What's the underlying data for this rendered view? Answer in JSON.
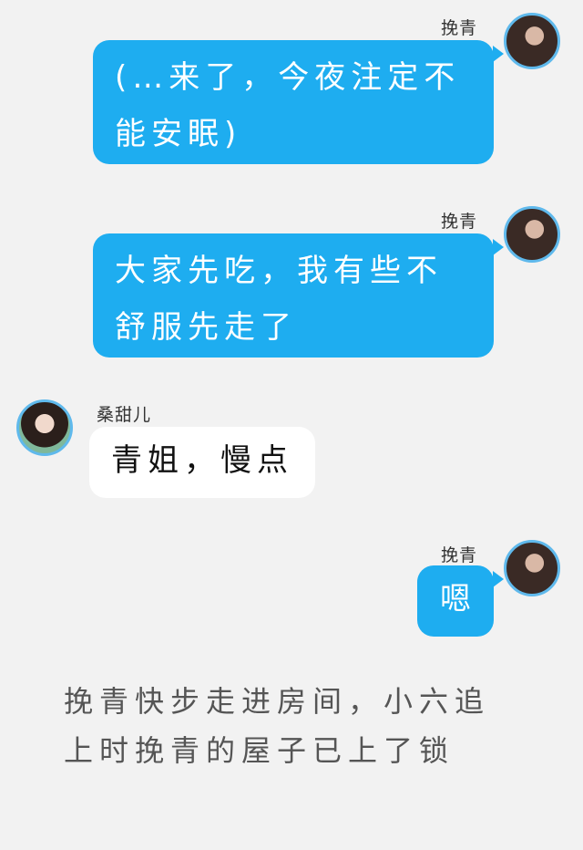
{
  "messages": [
    {
      "sender": "挽青",
      "side": "right",
      "text": "(…来了，今夜注定不能安眠)"
    },
    {
      "sender": "挽青",
      "side": "right",
      "text": "大家先吃，我有些不舒服先走了"
    },
    {
      "sender": "桑甜儿",
      "side": "left",
      "text": "青姐，慢点"
    },
    {
      "sender": "挽青",
      "side": "right",
      "text": "嗯"
    }
  ],
  "narration": "挽青快步走进房间，小六追上时挽青的屋子已上了锁",
  "colors": {
    "background": "#f2f2f2",
    "bubble_self": "#1eadf0",
    "bubble_other": "#ffffff",
    "avatar_ring": "#5fb9ec"
  }
}
